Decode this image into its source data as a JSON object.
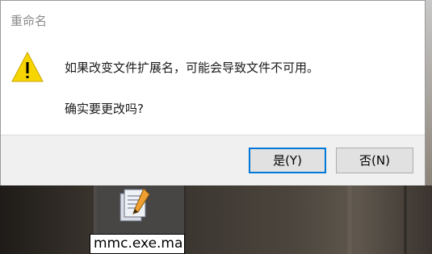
{
  "dialog": {
    "title": "重命名",
    "icon": "warning-icon",
    "message": "如果改变文件扩展名，可能会导致文件不可用。",
    "question": "确实要更改吗?",
    "buttons": {
      "yes_label": "是(Y)",
      "no_label": "否(N)"
    }
  },
  "desktop": {
    "file": {
      "icon": "document-with-pen-icon",
      "name": "mmc.exe.ma"
    }
  },
  "colors": {
    "accent": "#0078d7",
    "warning": "#f5d100",
    "footer_bg": "#f0f0f0"
  }
}
